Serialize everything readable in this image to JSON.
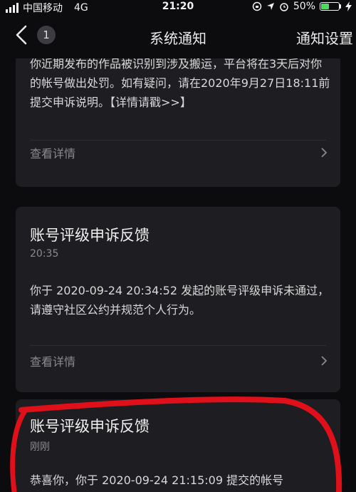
{
  "status_bar": {
    "carrier": "中国移动",
    "network": "4G",
    "time": "21:20",
    "battery_percent": "50%",
    "battery_level": 0.5
  },
  "nav": {
    "badge_count": "1",
    "title": "系统通知",
    "settings_label": "通知设置"
  },
  "notifications": [
    {
      "body": "你近期发布的作品被识别到涉及搬运，平台将在3天后对你的帐号做出处罚。如有疑问，请在2020年9月27日18:11前提交申诉说明。【详情请戳>>】",
      "footer": "查看详情"
    },
    {
      "title": "账号评级申诉反馈",
      "time": "20:35",
      "body": "你于 2020-09-24 20:34:52 发起的账号评级申诉未通过，请遵守社区公约并规范个人行为。",
      "footer": "查看详情"
    },
    {
      "title": "账号评级申诉反馈",
      "time": "刚刚",
      "body": "恭喜你，你于 2020-09-24 21:15:09 提交的帐号"
    }
  ],
  "colors": {
    "background": "#0c0c0e",
    "card": "#1e1e22",
    "annotation": "#e0101a",
    "battery": "#4cd964"
  }
}
